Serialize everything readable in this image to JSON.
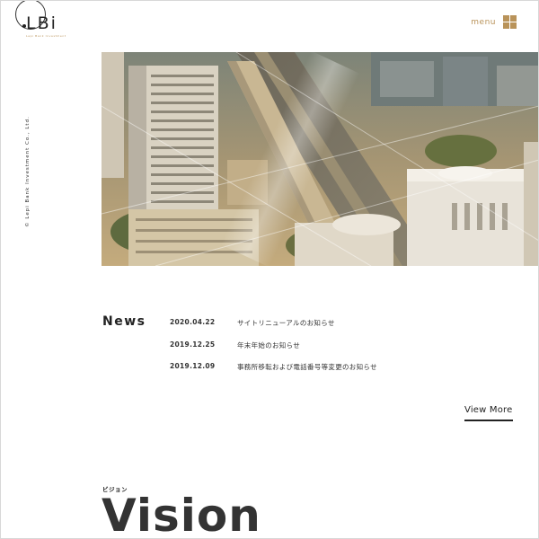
{
  "header": {
    "logo_text": "LBi",
    "logo_subtext": "Lepi Bank Investment",
    "menu_label": "menu",
    "menu_icon": "grid-icon",
    "brand_color": "#b9935a"
  },
  "sidebar": {
    "copyright": "© Lepi Bank Investment Co., Ltd."
  },
  "hero": {
    "image": "aerial-city-photo"
  },
  "news": {
    "title": "News",
    "items": [
      {
        "date": "2020.04.22",
        "text": "サイトリニューアルのお知らせ"
      },
      {
        "date": "2019.12.25",
        "text": "年末年始のお知らせ"
      },
      {
        "date": "2019.12.09",
        "text": "事務所移転および電話番号等変更のお知らせ"
      }
    ],
    "view_more": "View More"
  },
  "vision": {
    "kana": "ビジョン",
    "title": "Vision"
  }
}
